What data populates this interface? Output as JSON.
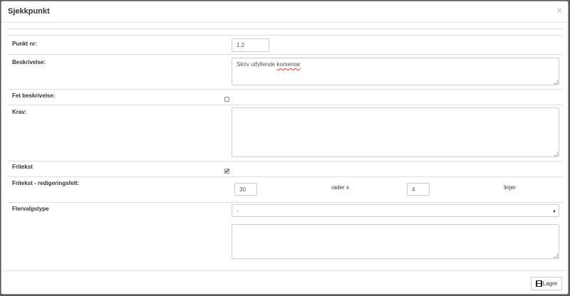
{
  "modal": {
    "title": "Sjekkpunkt",
    "close_symbol": "×"
  },
  "form": {
    "punkt_nr": {
      "label": "Punkt nr:",
      "value": "1.2"
    },
    "beskrivelse": {
      "label": "Beskrivelse:",
      "value_plain": "Skriv utfyllende ",
      "value_misspelled": "komentar"
    },
    "fet_beskrivelse": {
      "label": "Fet beskrivelse:",
      "checked": false
    },
    "krav": {
      "label": "Krav:",
      "value": ""
    },
    "fritekst": {
      "label": "Fritekst",
      "checked": true
    },
    "redigeringsfelt": {
      "label": "Fritekst - redigeringsfelt:",
      "rows_value": "30",
      "rows_unit": "rader x",
      "lines_value": "4",
      "lines_unit": "linjer"
    },
    "flervalgstype": {
      "label": "Flervalgstype",
      "selected": "-",
      "textarea_value": ""
    }
  },
  "footer": {
    "save_label": "Lagre",
    "save_icon": "floppy-disk-icon"
  }
}
